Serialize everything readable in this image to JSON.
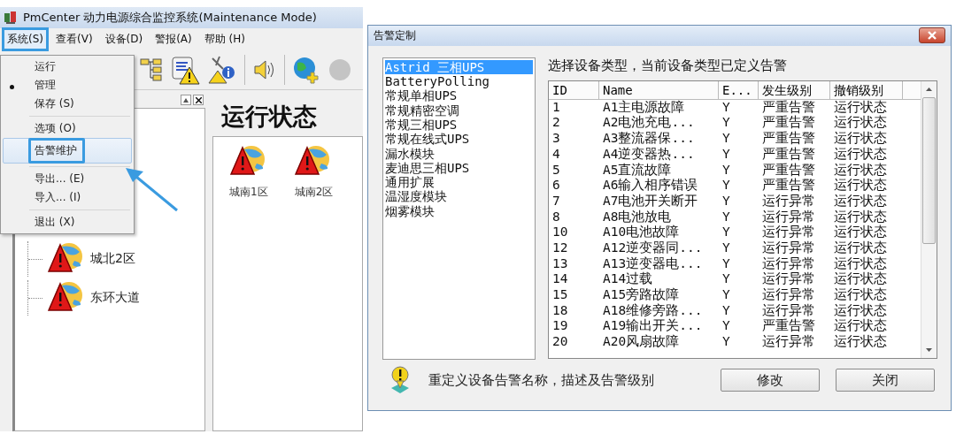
{
  "app_window": {
    "title": "PmCenter 动力电源综合监控系统(Maintenance Mode)",
    "menu_bar": [
      {
        "label": "系统(S)",
        "selected": true
      },
      {
        "label": "查看(V)",
        "selected": false
      },
      {
        "label": "设备(D)",
        "selected": false
      },
      {
        "label": "警报(A)",
        "selected": false
      },
      {
        "label": "帮助 (H)",
        "selected": false
      }
    ],
    "system_menu": [
      {
        "kind": "item",
        "label": "运行",
        "checked": false,
        "selected": false
      },
      {
        "kind": "item",
        "label": "管理",
        "checked": true,
        "selected": false
      },
      {
        "kind": "item",
        "label": "保存 (S)",
        "checked": false,
        "selected": false
      },
      {
        "kind": "separator"
      },
      {
        "kind": "item",
        "label": "选项 (O)",
        "checked": false,
        "selected": false
      },
      {
        "kind": "item",
        "label": "告警维护",
        "checked": false,
        "selected": true
      },
      {
        "kind": "separator"
      },
      {
        "kind": "item",
        "label": "导出... (E)",
        "checked": false,
        "selected": false
      },
      {
        "kind": "item",
        "label": "导入... (I)",
        "checked": false,
        "selected": false
      },
      {
        "kind": "separator"
      },
      {
        "kind": "item",
        "label": "退出 (X)",
        "checked": false,
        "selected": false
      }
    ],
    "tree": [
      {
        "label": "城北2区"
      },
      {
        "label": "东环大道"
      }
    ],
    "content": {
      "heading": "运行状态",
      "sites": [
        {
          "label": "城南1区"
        },
        {
          "label": "城南2区"
        }
      ]
    }
  },
  "dialog": {
    "title": "告警定制",
    "device_types": [
      {
        "label": "Astrid 三相UPS",
        "selected": true
      },
      {
        "label": "BatteryPolling",
        "selected": false
      },
      {
        "label": "常规单相UPS",
        "selected": false
      },
      {
        "label": "常规精密空调",
        "selected": false
      },
      {
        "label": "常规三相UPS",
        "selected": false
      },
      {
        "label": "常规在线式UPS",
        "selected": false
      },
      {
        "label": "漏水模块",
        "selected": false
      },
      {
        "label": "麦迪思三相UPS",
        "selected": false
      },
      {
        "label": "通用扩展",
        "selected": false
      },
      {
        "label": "温湿度模块",
        "selected": false
      },
      {
        "label": "烟雾模块",
        "selected": false
      }
    ],
    "prompt": "选择设备类型，当前设备类型已定义告警",
    "table": {
      "columns": [
        "ID",
        "Name",
        "E...",
        "发生级别",
        "撤销级别"
      ],
      "rows": [
        [
          "1",
          "A1主电源故障",
          "Y",
          "严重告警",
          "运行状态"
        ],
        [
          "2",
          "A2电池充电...",
          "Y",
          "严重告警",
          "运行状态"
        ],
        [
          "3",
          "A3整流器保...",
          "Y",
          "严重告警",
          "运行状态"
        ],
        [
          "4",
          "A4逆变器热...",
          "Y",
          "严重告警",
          "运行状态"
        ],
        [
          "5",
          "A5直流故障",
          "Y",
          "严重告警",
          "运行状态"
        ],
        [
          "6",
          "A6输入相序错误",
          "Y",
          "严重告警",
          "运行状态"
        ],
        [
          "7",
          "A7电池开关断开",
          "Y",
          "运行异常",
          "运行状态"
        ],
        [
          "8",
          "A8电池放电",
          "Y",
          "运行异常",
          "运行状态"
        ],
        [
          "10",
          "A10电池故障",
          "Y",
          "运行异常",
          "运行状态"
        ],
        [
          "12",
          "A12逆变器同...",
          "Y",
          "运行异常",
          "运行状态"
        ],
        [
          "13",
          "A13逆变器电...",
          "Y",
          "运行异常",
          "运行状态"
        ],
        [
          "14",
          "A14过载",
          "Y",
          "运行异常",
          "运行状态"
        ],
        [
          "15",
          "A15旁路故障",
          "Y",
          "运行异常",
          "运行状态"
        ],
        [
          "18",
          "A18维修旁路...",
          "Y",
          "运行异常",
          "运行状态"
        ],
        [
          "19",
          "A19输出开关...",
          "Y",
          "严重告警",
          "运行状态"
        ],
        [
          "20",
          "A20风扇故障",
          "Y",
          "运行异常",
          "运行状态"
        ]
      ]
    },
    "hint": "重定义设备告警名称，描述及告警级别",
    "buttons": [
      "修改",
      "关闭"
    ]
  }
}
